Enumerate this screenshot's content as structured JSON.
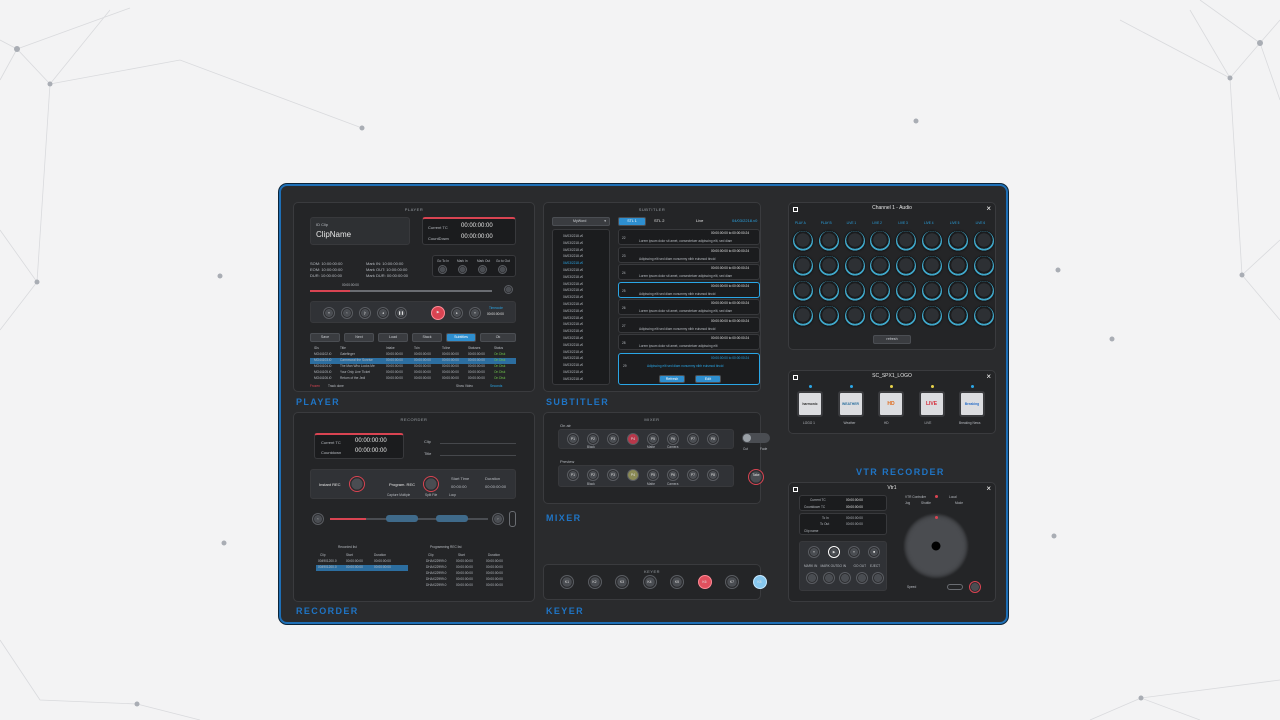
{
  "app": {
    "sections": {
      "player": "PLAYER",
      "subtitler": "SUBTITLER",
      "recorder": "RECORDER",
      "mixer": "MIXER",
      "keyer": "KEYER",
      "vtr_recorder": "VTR RECORDER"
    }
  },
  "player": {
    "title": "PLAYER",
    "clip_label": "ID Clip",
    "clip_name": "ClipName",
    "current_tc_label": "Current TC",
    "current_tc": "00:00:00:00",
    "countdown_label": "CountDown",
    "countdown": "00:00:00:00",
    "info": [
      [
        "SOM: 10:00:00:00",
        "Mark IN: 10:00:00:00"
      ],
      [
        "EOM: 10:00:00:00",
        "Mark OUT: 10:00:00:00"
      ],
      [
        "DUR: 10:00:00:00",
        "Mark DUR: 00:00:00:00"
      ]
    ],
    "goto_labels": [
      "Go To In",
      "Mark In",
      "Mark Out",
      "Go to Out"
    ],
    "scrub_left": "00:00:00:00",
    "scrub_right": "00:00:00:00",
    "transport_right": "Timecode",
    "transport_value": "00:00:00:00",
    "tabs": [
      "Save",
      "Next",
      "Load",
      "Stack",
      "Subtitles",
      "Ok"
    ],
    "table": {
      "headers": [
        "IDs",
        "Title",
        "Intake",
        "Tcin",
        "Tcline",
        "Statuses",
        "Status"
      ],
      "rows": [
        [
          "MO44102.i0",
          "Gatefinger",
          "00:00:00:00",
          "00:00:00:00",
          "00:00:00:00",
          "00:00:00:00",
          "On Disk"
        ],
        [
          "MO44103.i0",
          "Carmmoral the Sunrise",
          "00:00:00:00",
          "00:00:00:00",
          "00:00:00:00",
          "00:00:00:00",
          "On Disk"
        ],
        [
          "MO44104.i0",
          "The Man Who Looks Me",
          "00:00:00:00",
          "00:00:00:00",
          "00:00:00:00",
          "00:00:00:00",
          "On Disk"
        ],
        [
          "MO44105.i0",
          "Your Only Line Ticket",
          "00:00:00:00",
          "00:00:00:00",
          "00:00:00:00",
          "00:00:00:00",
          "On Disk"
        ],
        [
          "MO44106.i0",
          "Return of the Jedi",
          "00:00:00:00",
          "00:00:00:00",
          "00:00:00:00",
          "00:00:00:00",
          "On Disk"
        ]
      ]
    },
    "footer_left": "Frozen",
    "footer_mid": "Track done",
    "footer_right": "Show Video",
    "footer_right_val": "Seconds"
  },
  "subtitler": {
    "title": "SUBTITLER",
    "dropdown": "MyWord",
    "tab_active": "STL 1",
    "tab_two": "STL 2",
    "live": "Live",
    "live_code": "04/03/2218.v0",
    "files": [
      "04/03/2218.v0",
      "04/03/2218.v0",
      "04/03/2218.v0",
      "04/03/2218.v0",
      "04/03/2218.v0",
      "04/03/2218.v0",
      "04/03/2218.v0",
      "04/03/2218.v0",
      "04/03/2218.v0",
      "04/03/2218.v0",
      "04/03/2218.v0",
      "04/03/2218.v0",
      "04/03/2218.v0",
      "04/03/2218.v0",
      "04/03/2218.v0",
      "04/03/2218.v0",
      "04/03/2218.v0",
      "04/03/2218.v0",
      "04/03/2218.v0",
      "04/03/2218.v0",
      "04/03/2218.v0",
      "04/03/2218.v0"
    ],
    "entries": [
      {
        "n": "22",
        "tc": "00:00:00:00 to 00:00:00:24",
        "text": "Lorem ipsum dolor sit amet, consectetuer adipiscing elit, sed diam"
      },
      {
        "n": "23",
        "tc": "00:00:00:00 to 00:00:00:24",
        "text": "Adipiscing elit sed diam nonummy nibh euismod tincid"
      },
      {
        "n": "24",
        "tc": "00:00:00:00 to 00:00:00:24",
        "text": "Lorem ipsum dolor sit amet, consectetuer adipiscing elit, sed diam"
      },
      {
        "n": "25",
        "tc": "00:00:00:00 to 00:00:00:24",
        "text": "Adipiscing elit sed diam nonummy nibh euismod tincid"
      },
      {
        "n": "26",
        "tc": "00:00:00:00 to 00:00:00:24",
        "text": "Lorem ipsum dolor sit amet, consectetuer adipiscing elit, sed diam"
      },
      {
        "n": "27",
        "tc": "00:00:00:00 to 00:00:00:24",
        "text": "Adipiscing elit sed diam nonummy nibh euismod tincid"
      },
      {
        "n": "28",
        "tc": "00:00:00:00 to 00:00:00:24",
        "text": "Lorem ipsum dolor sit amet, consectetuer adipiscing elit"
      }
    ],
    "active": {
      "n": "29",
      "tc": "00:00:00:00 to 00:00:00:24",
      "text": "Adipiscing elit sed diam nonummy nibh euismod tincid",
      "btn1": "Refresh",
      "btn2": "Edit"
    }
  },
  "audio": {
    "title": "Channel 1 - Audio",
    "cols": [
      "PLAY A",
      "PLAY B",
      "LIVE 1",
      "LIVE 2",
      "LIVE 3",
      "LIVE 4",
      "LIVE 5",
      "LIVE 6"
    ],
    "refresh": "refresh"
  },
  "logo": {
    "title": "SC_SPX1_LOGO",
    "items": [
      {
        "label": "LOGO 1",
        "text": "harmonic",
        "color": "#2f2f2f",
        "dot": "#2aa6e6"
      },
      {
        "label": "Weather",
        "text": "WEATHER",
        "color": "#2a6f9e",
        "dot": "#2aa6e6"
      },
      {
        "label": "HD",
        "text": "HD",
        "color": "#e06a1a",
        "dot": "#e8d24a"
      },
      {
        "label": "LIVE",
        "text": "LIVE",
        "color": "#d62c3a",
        "dot": "#e8d24a"
      },
      {
        "label": "Breaking News",
        "text": "Breaking News",
        "color": "#2a6fc8",
        "dot": "#2aa6e6"
      }
    ]
  },
  "recorder": {
    "title": "RECORDER",
    "current_tc_label": "Current TC",
    "current_tc": "00:00:00:00",
    "countdown_label": "Countdown",
    "countdown": "00:00:00:00",
    "clip_label": "Clip",
    "title_label": "Title",
    "instant": "Instant REC",
    "program": "Program. REC",
    "start_label": "Start Time",
    "start_val": "00:00:00",
    "duration_label": "Duration",
    "duration_val": "00:00:00:00",
    "opt1": "Capture Multiple",
    "opt2": "Split File",
    "opt3": "Loop",
    "list1": "Recorded list",
    "list2": "Programming REC list",
    "rec_headers": [
      "Clip",
      "Start",
      "Duration"
    ],
    "rec_rows": [
      [
        "004901200.0",
        "00:00:00:00",
        "00:00:00:00"
      ],
      [
        "004901200.0",
        "00:00:00:00",
        "00:00:00:00"
      ]
    ],
    "prog_headers": [
      "Clip",
      "Start",
      "Duration"
    ],
    "prog_rows": [
      [
        "DHAX22999.0",
        "00:00:00:00",
        "00:00:00:00"
      ],
      [
        "DHAX22999.0",
        "00:00:00:00",
        "00:00:00:00"
      ],
      [
        "DHAX22999.0",
        "00:00:00:00",
        "00:00:00:00"
      ],
      [
        "DHAX22999.0",
        "00:00:00:00",
        "00:00:00:00"
      ],
      [
        "DHAX22999.0",
        "00:00:00:00",
        "00:00:00:00"
      ]
    ]
  },
  "mixer": {
    "title": "MIXER",
    "on_air": "On air",
    "preview": "Preview",
    "row1": [
      "P1",
      "P2",
      "P3",
      "P4",
      "P5",
      "P6",
      "P7",
      "P8"
    ],
    "row2": [
      "P1",
      "P2",
      "P3",
      "P4",
      "P5",
      "P6",
      "P7",
      "P8"
    ],
    "sub1": [
      "",
      "Black",
      "",
      "",
      "Matte",
      "Camera",
      "",
      ""
    ],
    "cut": "Cut",
    "fade": "Fade",
    "take": "Take"
  },
  "keyer": {
    "title": "KEYER",
    "buttons": [
      "K1",
      "K2",
      "K3",
      "K4",
      "K5",
      "K6",
      "K7",
      "K8"
    ]
  },
  "vtr": {
    "title": "Vtr1",
    "current_tc_label": "Current TC",
    "current_tc": "00:00:00:00",
    "countdown_label": "Countdown TC",
    "countdown": "00:00:00:00",
    "tcin_label": "Tc In",
    "tcin": "00:00:00:00",
    "tcout_label": "Tc Out",
    "tcout": "00:00:00:00",
    "clip_label": "Clip name",
    "vtr_control": "VTR Controller",
    "local": "Local",
    "shuttle": "Shuttle",
    "jog": "Jog",
    "mode": "Mode",
    "speed": "Speed",
    "labels": [
      "MARK IN",
      "MARK OUT",
      "GO IN",
      "GO OUT",
      "EJECT"
    ]
  }
}
